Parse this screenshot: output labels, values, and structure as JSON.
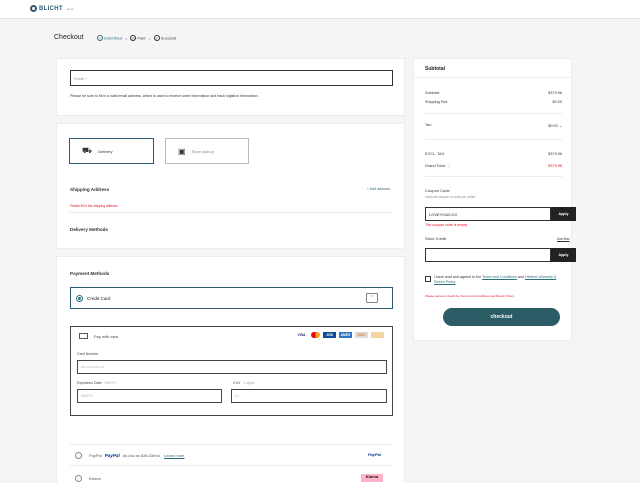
{
  "brand": {
    "name": "BLICHT",
    "sub": "store"
  },
  "checkout": {
    "title": "Checkout",
    "steps": [
      {
        "label": "Submitted",
        "icon": "check-circle-icon",
        "state": "active"
      },
      {
        "label": "Paid",
        "icon": "clock-icon",
        "state": "inactive"
      },
      {
        "label": "Succeed",
        "icon": "check-circle-icon",
        "state": "inactive"
      }
    ],
    "sep": ">"
  },
  "email": {
    "placeholder": "Email *",
    "note": "Please be sure to fill in a valid email address, which is used to receive order information and track logistics information."
  },
  "shipping": {
    "methods": [
      {
        "label": "Delivery",
        "icon": "truck-icon",
        "selected": true
      },
      {
        "label": "Store pickup",
        "icon": "store-icon",
        "selected": false
      }
    ],
    "address_title": "Shipping Address",
    "add_address": "+ Add address",
    "address_error": "Please fill in the shipping address.",
    "delivery_methods": "Delivery Methods"
  },
  "payment": {
    "title": "Payment Methods",
    "credit_card": "Credit Card",
    "credit_card_icon": "credit-card-icon",
    "pay_with_card": "Pay with card",
    "brands": [
      "VISA",
      "",
      "JCB",
      "AMEX",
      "DISC",
      ""
    ],
    "card_number_label": "Card Number",
    "card_number_placeholder": "•••• •••• •••• ••••",
    "expiry_label": "Expiration Date",
    "expiry_hint": "MM/YY",
    "expiry_placeholder": "MM/YY",
    "cvv_label": "CVV",
    "cvv_hint": "3 digits",
    "cvv_placeholder": "•••",
    "paypal_label": "PayPal",
    "paypal_logo": "PayPal",
    "paypal_note": "As low as $36.33/mo.",
    "paypal_learn": "Learn more",
    "paypal_badge": "PayPal",
    "klarna_label": "Klarna",
    "klarna_badge": "Klarna"
  },
  "summary": {
    "title": "Subtotal",
    "subtotal_label": "Subtotal:",
    "subtotal_value": "$379.96",
    "shipping_label": "Shipping Fee:",
    "shipping_value": "$0.00",
    "tax_label": "Tax:",
    "tax_value": "$0.00",
    "excl_tax_label": "EXCL. TAX:",
    "excl_tax_value": "$379.96",
    "grand_total_label": "Grand Total:",
    "grand_total_value": "$379.96",
    "coupon_label": "Coupon Code",
    "coupon_sub": "Limit one coupon or code per order!",
    "coupon_value": "LOVEYOU0.C0",
    "apply_label": "Apply",
    "coupon_error": "The coupon code is empty",
    "store_credit_label": "Store Credit",
    "use_all": "Use Max",
    "agree_text": "I have read and agreed to the",
    "terms_link": "Terms and Conditions",
    "and_text": "and",
    "warranty_link": "Lifetime Warranty & Return Policy",
    "agree_error": "Please agree to check the Terms and Conditions and Return Policy.",
    "checkout_label": "checkout"
  }
}
